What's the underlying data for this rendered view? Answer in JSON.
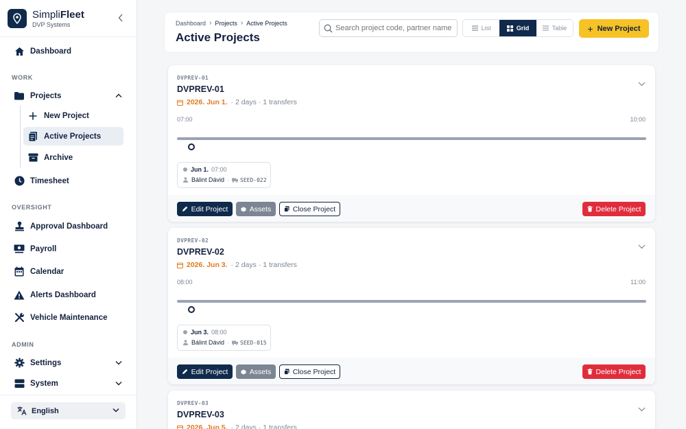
{
  "sidebar": {
    "brand_light": "Simpli",
    "brand_bold": "Fleet",
    "brand_sub": "DVP Systems",
    "dashboard": "Dashboard",
    "section_work": "WORK",
    "projects": "Projects",
    "new_project": "New Project",
    "active_projects": "Active Projects",
    "archive": "Archive",
    "timesheet": "Timesheet",
    "section_oversight": "OVERSIGHT",
    "approval_dashboard": "Approval Dashboard",
    "payroll": "Payroll",
    "calendar": "Calendar",
    "alerts_dashboard": "Alerts Dashboard",
    "vehicle_maintenance": "Vehicle Maintenance",
    "section_admin": "ADMIN",
    "settings": "Settings",
    "system": "System",
    "language": "English"
  },
  "header": {
    "breadcrumb": [
      "Dashboard",
      "Projects",
      "Active Projects"
    ],
    "title": "Active Projects",
    "search_placeholder": "Search project code, partner name o",
    "views": [
      "List",
      "Grid",
      "Table"
    ],
    "active_view": "Grid",
    "new_project_label": "New Project"
  },
  "projects": [
    {
      "code": "DVPREV-01",
      "title": "DVPREV-01",
      "date": "2026. Jun 1.",
      "meta": "· 2 days · 1 transfers",
      "start": "07:00",
      "end": "10:00",
      "transfer_date": "Jun 1.",
      "transfer_time": "07:00",
      "driver": "Bálint Dávid",
      "vehicle": "SEED-022"
    },
    {
      "code": "DVPREV-02",
      "title": "DVPREV-02",
      "date": "2026. Jun 3.",
      "meta": "· 2 days · 1 transfers",
      "start": "08:00",
      "end": "11:00",
      "transfer_date": "Jun 3.",
      "transfer_time": "08:00",
      "driver": "Bálint Dávid",
      "vehicle": "SEED-015"
    },
    {
      "code": "DVPREV-03",
      "title": "DVPREV-03",
      "date": "2026. Jun 5.",
      "meta": "· 2 days · 1 transfers"
    }
  ],
  "actions": {
    "edit": "Edit Project",
    "assets": "Assets",
    "close": "Close Project",
    "delete": "Delete Project"
  },
  "colors": {
    "navy": "#102a4c",
    "accent_yellow": "#f6c225",
    "date_orange": "#e07a1f",
    "danger": "#e02d3c"
  }
}
